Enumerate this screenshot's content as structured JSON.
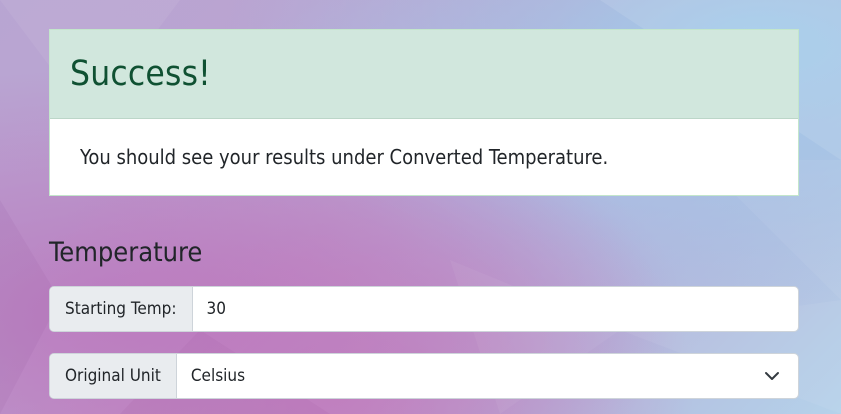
{
  "alert": {
    "title": "Success!",
    "message": "You should see your results under Converted Temperature."
  },
  "temperature_section": {
    "heading": "Temperature",
    "starting_temp": {
      "label": "Starting Temp:",
      "value": "30"
    },
    "original_unit": {
      "label": "Original Unit",
      "selected": "Celsius"
    }
  },
  "colors": {
    "alert_header_bg": "#d1e7dd",
    "alert_title": "#0f5132",
    "addon_bg": "#e9ecef",
    "border": "#ced4da"
  },
  "icons": {
    "select_indicator": "chevron-down-icon"
  }
}
